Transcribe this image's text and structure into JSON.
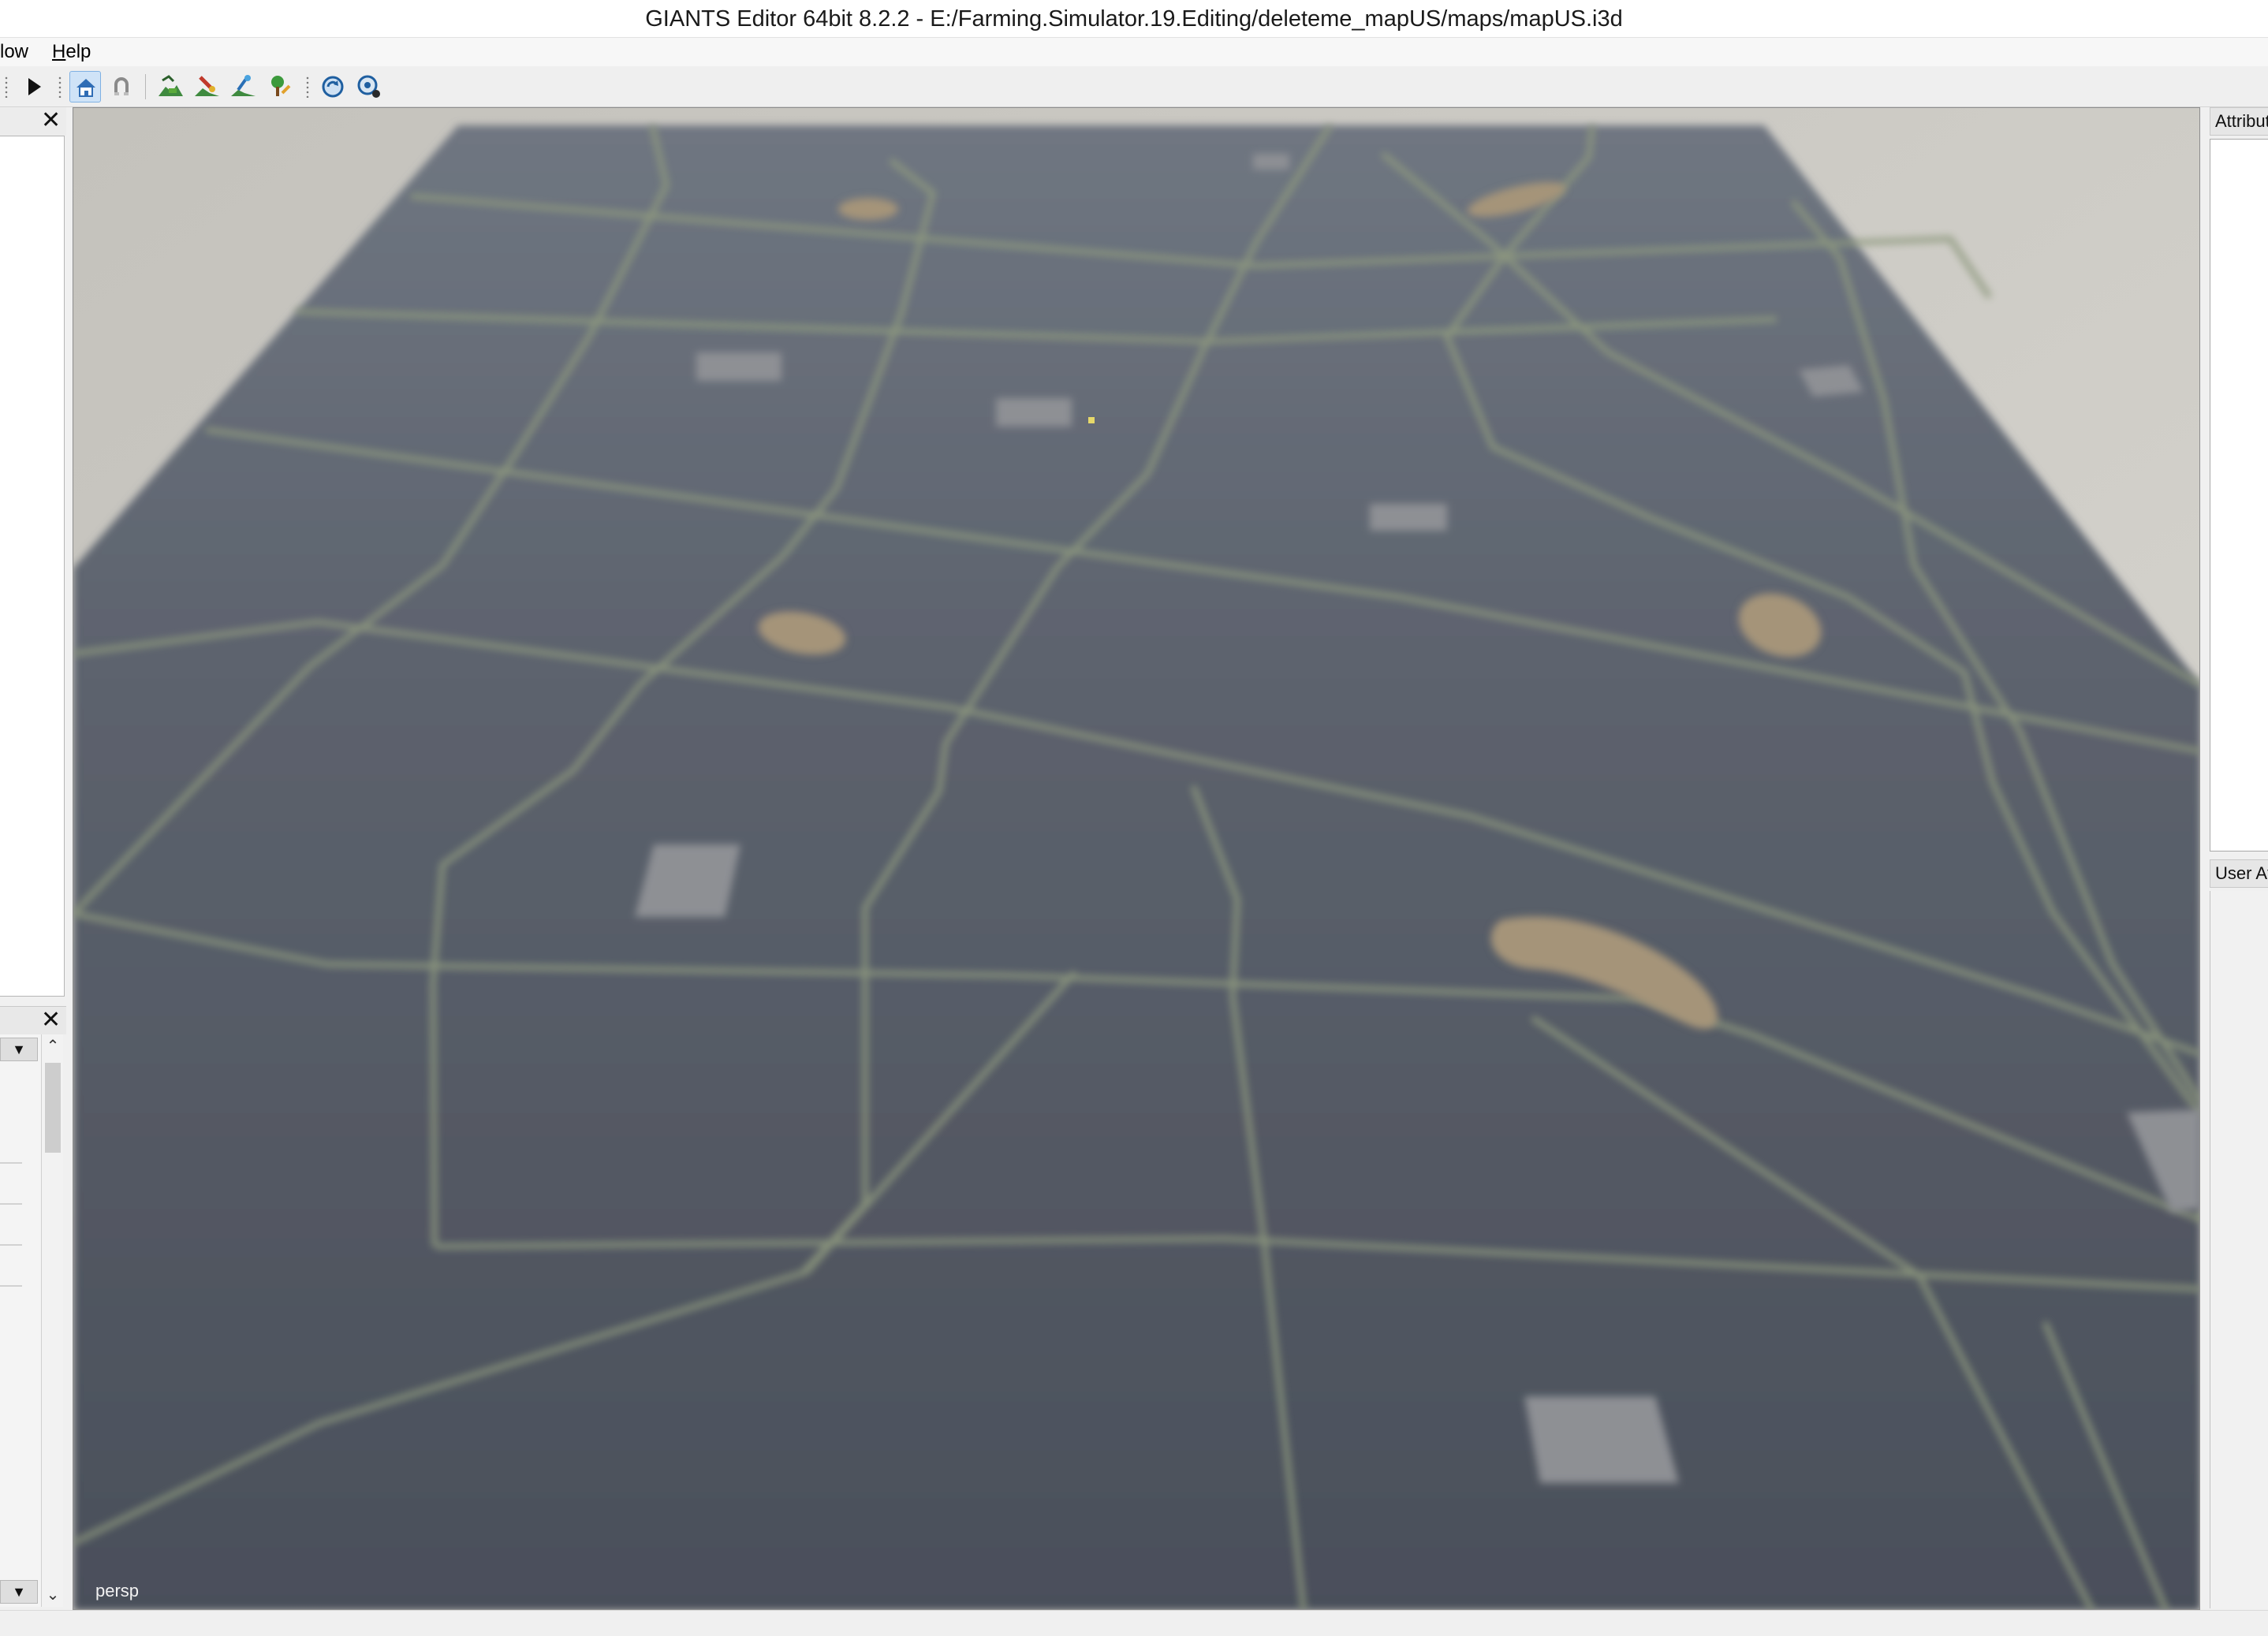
{
  "window": {
    "title": "GIANTS Editor 64bit 8.2.2 - E:/Farming.Simulator.19.Editing/deleteme_mapUS/maps/mapUS.i3d"
  },
  "menu": {
    "items": [
      "low",
      "Help"
    ]
  },
  "toolbar": {
    "buttons": [
      "play-icon",
      "home-camera-icon",
      "magnet-icon",
      "terrain-paint-icon",
      "terrain-sculpt-icon",
      "foliage-paint-icon",
      "tree-paint-icon",
      "refresh-icon",
      "settings-refresh-icon"
    ]
  },
  "panels": {
    "right_top_title": "Attribut",
    "right_bottom_title": "User At"
  },
  "viewport": {
    "camera_label": "persp"
  }
}
